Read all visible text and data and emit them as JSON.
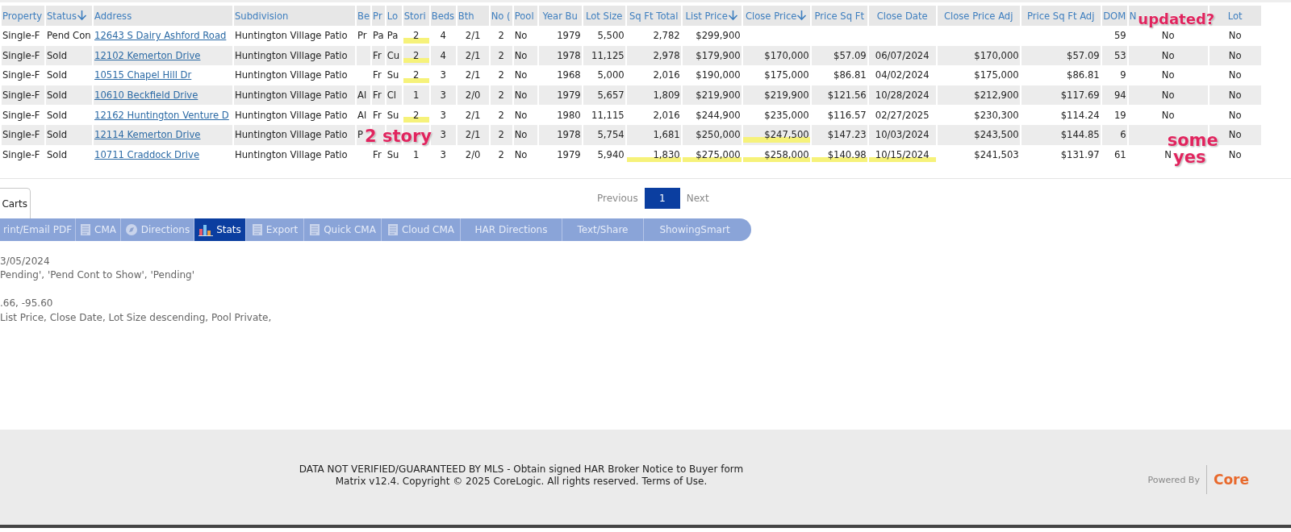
{
  "table": {
    "columns": [
      {
        "label": "Property",
        "sorted": false
      },
      {
        "label": "Status",
        "sorted": true
      },
      {
        "label": "Address",
        "sorted": false
      },
      {
        "label": "Subdivision",
        "sorted": false
      },
      {
        "label": "Be",
        "sorted": false
      },
      {
        "label": "Pr",
        "sorted": false
      },
      {
        "label": "Lo",
        "sorted": false
      },
      {
        "label": "Stori",
        "sorted": false
      },
      {
        "label": "Beds",
        "sorted": false
      },
      {
        "label": "Bth",
        "sorted": false
      },
      {
        "label": "No (",
        "sorted": false
      },
      {
        "label": "Pool",
        "sorted": false
      },
      {
        "label": "Year Bu",
        "sorted": false
      },
      {
        "label": "Lot Size",
        "sorted": false
      },
      {
        "label": "Sq Ft Total",
        "sorted": false
      },
      {
        "label": "List Price",
        "sorted": true
      },
      {
        "label": "Close Price",
        "sorted": true
      },
      {
        "label": "Price Sq Ft",
        "sorted": false
      },
      {
        "label": "Close Date",
        "sorted": false
      },
      {
        "label": "Close Price Adj",
        "sorted": false
      },
      {
        "label": "Price Sq Ft Adj",
        "sorted": false
      },
      {
        "label": "DOM",
        "sorted": false
      },
      {
        "label": "N",
        "sorted": false
      },
      {
        "label": "Lot",
        "sorted": false
      }
    ],
    "rows": [
      {
        "cells": [
          "Single-F",
          "Pend Con",
          "12643 S Dairy Ashford Road",
          "Huntington Village Patio",
          "Pr",
          "Pa",
          "Pa",
          "2",
          "4",
          "2/1",
          "2",
          "No",
          "1979",
          "5,500",
          "2,782",
          "$299,900",
          null,
          null,
          null,
          null,
          null,
          "59",
          "No",
          "No"
        ],
        "highlighted": [
          false,
          false,
          false,
          false,
          false,
          false,
          false,
          true,
          false,
          false,
          false,
          false,
          false,
          false,
          false,
          false,
          false,
          false,
          false,
          false,
          false,
          false,
          false,
          false
        ]
      },
      {
        "cells": [
          "Single-F",
          "Sold",
          "12102 Kemerton Drive",
          "Huntington Village Patio",
          null,
          "Fr",
          "Cu",
          "2",
          "4",
          "2/1",
          "2",
          "No",
          "1978",
          "11,125",
          "2,978",
          "$179,900",
          "$170,000",
          "$57.09",
          "06/07/2024",
          "$170,000",
          "$57.09",
          "53",
          "No",
          "No"
        ],
        "highlighted": [
          false,
          false,
          false,
          false,
          false,
          false,
          false,
          true,
          false,
          false,
          false,
          false,
          false,
          false,
          false,
          false,
          false,
          false,
          false,
          false,
          false,
          false,
          false,
          false
        ]
      },
      {
        "cells": [
          "Single-F",
          "Sold",
          "10515 Chapel Hill Dr",
          "Huntington Village Patio",
          null,
          "Fr",
          "Su",
          "2",
          "3",
          "2/1",
          "2",
          "No",
          "1968",
          "5,000",
          "2,016",
          "$190,000",
          "$175,000",
          "$86.81",
          "04/02/2024",
          "$175,000",
          "$86.81",
          "9",
          "No",
          "No"
        ],
        "highlighted": [
          false,
          false,
          false,
          false,
          false,
          false,
          false,
          true,
          false,
          false,
          false,
          false,
          false,
          false,
          false,
          false,
          false,
          false,
          false,
          false,
          false,
          false,
          false,
          false
        ]
      },
      {
        "cells": [
          "Single-F",
          "Sold",
          "10610 Beckfield Drive",
          "Huntington Village Patio",
          "Al",
          "Fr",
          "Cl",
          "1",
          "3",
          "2/0",
          "2",
          "No",
          "1979",
          "5,657",
          "1,809",
          "$219,900",
          "$219,900",
          "$121.56",
          "10/28/2024",
          "$212,900",
          "$117.69",
          "94",
          "No",
          "No"
        ],
        "highlighted": [
          false,
          false,
          false,
          false,
          false,
          false,
          false,
          false,
          false,
          false,
          false,
          false,
          false,
          false,
          false,
          false,
          false,
          false,
          false,
          false,
          false,
          false,
          false,
          false
        ]
      },
      {
        "cells": [
          "Single-F",
          "Sold",
          "12162 Huntington Venture D",
          "Huntington Village Patio",
          "Al",
          "Fr",
          "Su",
          "2",
          "3",
          "2/1",
          "2",
          "No",
          "1980",
          "11,115",
          "2,016",
          "$244,900",
          "$235,000",
          "$116.57",
          "02/27/2025",
          "$230,300",
          "$114.24",
          "19",
          "No",
          "No"
        ],
        "highlighted": [
          false,
          false,
          false,
          false,
          false,
          false,
          false,
          true,
          false,
          false,
          false,
          false,
          false,
          false,
          false,
          false,
          false,
          false,
          false,
          false,
          false,
          false,
          false,
          false
        ]
      },
      {
        "cells": [
          "Single-F",
          "Sold",
          "12114 Kemerton Drive",
          "Huntington Village Patio",
          "P",
          null,
          null,
          null,
          "3",
          "2/1",
          "2",
          "No",
          "1978",
          "5,754",
          "1,681",
          "$250,000",
          "$247,500",
          "$147.23",
          "10/03/2024",
          "$243,500",
          "$144.85",
          "6",
          null,
          "No"
        ],
        "highlighted": [
          false,
          false,
          false,
          false,
          false,
          false,
          false,
          false,
          false,
          false,
          false,
          false,
          false,
          false,
          false,
          false,
          true,
          false,
          false,
          false,
          false,
          false,
          false,
          false
        ]
      },
      {
        "cells": [
          "Single-F",
          "Sold",
          "10711 Craddock Drive",
          "Huntington Village Patio",
          null,
          "Fr",
          "Su",
          "1",
          "3",
          "2/0",
          "2",
          "No",
          "1979",
          "5,940",
          "1,830",
          "$275,000",
          "$258,000",
          "$140.98",
          "10/15/2024",
          "$241,503",
          "$131.97",
          "61",
          "N",
          "No"
        ],
        "highlighted": [
          false,
          false,
          false,
          false,
          false,
          false,
          false,
          false,
          false,
          false,
          false,
          false,
          false,
          false,
          true,
          true,
          true,
          true,
          true,
          false,
          false,
          false,
          false,
          false
        ]
      }
    ]
  },
  "annotations": [
    {
      "text": "updated?"
    },
    {
      "text": "2 story"
    },
    {
      "text": "some"
    },
    {
      "text": "yes"
    }
  ],
  "tab": {
    "label": "Carts",
    "selected": true
  },
  "pagination": {
    "previous": {
      "label": "Previous",
      "disabled": true
    },
    "pages": [
      {
        "label": "1",
        "selected": true
      }
    ],
    "next": {
      "label": "Next",
      "disabled": true
    }
  },
  "toolbar": [
    {
      "label": "rint/Email PDF",
      "kind": "none",
      "selected": false
    },
    {
      "label": "CMA",
      "kind": "document",
      "selected": false
    },
    {
      "label": "Directions",
      "kind": "compass",
      "selected": false
    },
    {
      "label": "Stats",
      "kind": "chart",
      "selected": true
    },
    {
      "label": "Export",
      "kind": "document",
      "selected": false
    },
    {
      "label": "Quick CMA",
      "kind": "document",
      "selected": false
    },
    {
      "label": "Cloud CMA",
      "kind": "document",
      "selected": false
    },
    {
      "label": "HAR Directions",
      "kind": "none",
      "selected": false
    },
    {
      "label": "Text/Share",
      "kind": "none",
      "selected": false
    },
    {
      "label": "ShowingSmart",
      "kind": "none",
      "selected": false
    }
  ],
  "criteria": [
    [
      "3/05/2024",
      "Pending', 'Pend Cont to Show', 'Pending'"
    ],
    [
      ".66, -95.60",
      "List Price, Close Date, Lot Size descending, Pool Private,"
    ]
  ],
  "footer": {
    "lines": [
      "DATA NOT VERIFIED/GUARANTEED BY MLS - Obtain signed HAR Broker Notice to Buyer form",
      "Matrix v12.4. Copyright © 2025 CoreLogic. All rights reserved. Terms of Use."
    ],
    "powered_by": "Powered By",
    "brand": "Core"
  }
}
